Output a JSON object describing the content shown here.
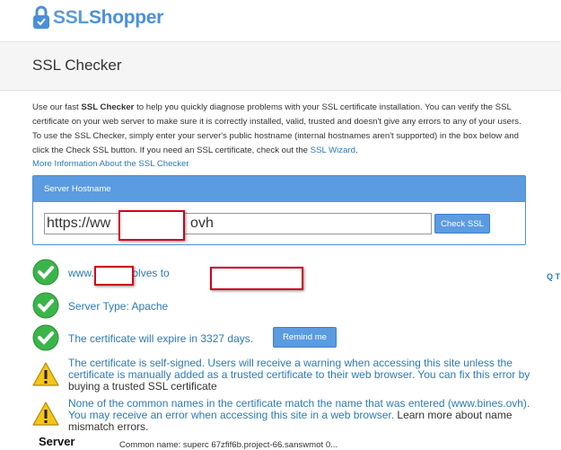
{
  "logo": {
    "ssl": "SSL",
    "shopper": "Shopper"
  },
  "page_title": "SSL Checker",
  "intro": {
    "p1": "Use our fast ",
    "b1": "SSL Checker",
    "p2": " to help you quickly diagnose problems with your SSL certificate installation. You can verify the SSL certificate on your web server to make sure it is correctly installed, valid, trusted and doesn't give any errors to any of your users. To use the SSL Checker, simply enter your server's public hostname (internal hostnames aren't supported) in the box below and click the Check SSL button. If you need an SSL certificate, check out the ",
    "link": "SSL Wizard",
    "p3": "."
  },
  "more_link": "More Information About the SSL Checker",
  "panel": {
    "title": "Server Hostname",
    "input_value": "https://ww                    ovh",
    "button": "Check SSL"
  },
  "results": {
    "resolves": "www.          ovh resolves to",
    "server_type": "Server Type: Apache",
    "expire": "The certificate will expire in 3327 days.",
    "remind": "Remind me",
    "selfsigned_a": "The certificate is self-signed. Users will receive a warning when accessing this site unless the certificate is manually added as a trusted certificate to their web browser. You can fix this error by ",
    "selfsigned_b": "buying a trusted SSL certificate",
    "mismatch_a": "None of the common names in the certificate match the name that was entered (www.bines.ovh). You may receive an error when accessing this site in a web browser. ",
    "mismatch_b": "Learn more about name mismatch errors."
  },
  "side_tab": "Q T",
  "server_logo": "Server",
  "bottom_text": "Common name: superc 67zfif6b.project-66.sanswmot 0..."
}
